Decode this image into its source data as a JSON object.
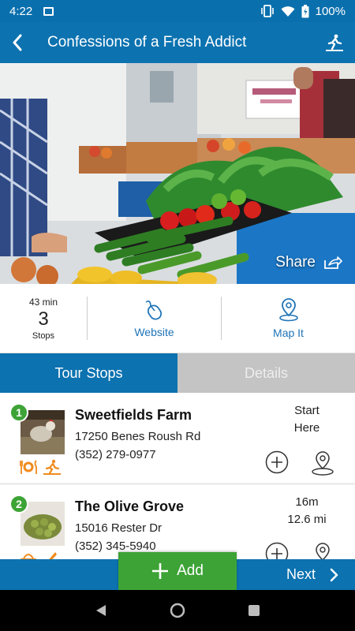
{
  "status_bar": {
    "time": "4:22",
    "battery": "100%"
  },
  "app_bar": {
    "title": "Confessions of a Fresh Addict"
  },
  "hero": {
    "share_label": "Share"
  },
  "info": {
    "duration": "43 min",
    "stop_count": "3",
    "stop_unit": "Stops",
    "website_label": "Website",
    "map_label": "Map It"
  },
  "tabs": [
    {
      "label": "Tour Stops",
      "active": true
    },
    {
      "label": "Details",
      "active": false
    }
  ],
  "stops": [
    {
      "number": "1",
      "name": "Sweetfields Farm",
      "address": "17250 Benes Roush Rd",
      "phone": "(352) 279-0977",
      "right_line1": "Start",
      "right_line2": "Here"
    },
    {
      "number": "2",
      "name": "The Olive Grove",
      "address": "15016 Rester Dr",
      "phone": "(352) 345-5940",
      "right_line1": "16m",
      "right_line2": "12.6 mi"
    }
  ],
  "bottom": {
    "add_label": "Add",
    "next_label": "Next"
  },
  "colors": {
    "primary": "#0c72b0",
    "green": "#3da336",
    "amenity": "#f08a1c"
  }
}
